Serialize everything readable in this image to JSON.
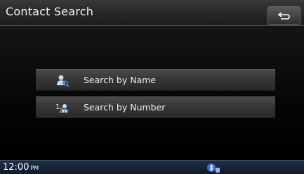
{
  "header": {
    "title": "Contact Search"
  },
  "menu": {
    "items": [
      {
        "label": "Search by Name",
        "icon": "person-search-icon"
      },
      {
        "label": "Search by Number",
        "icon": "number-search-icon"
      }
    ]
  },
  "status": {
    "time": "12:00",
    "ampm": "PM",
    "icon": "bluetooth-phone-icon"
  },
  "colors": {
    "background": "#000000",
    "button": "#3a3a3a",
    "status_bar": "#14233a",
    "accent_blue": "#4a7fd6"
  }
}
